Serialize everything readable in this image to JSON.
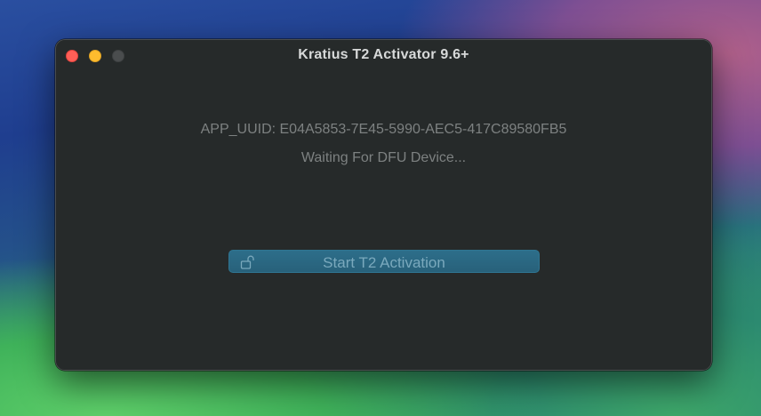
{
  "window": {
    "title": "Kratius T2 Activator 9.6+",
    "traffic_lights": {
      "close": "#fe5f57",
      "minimize": "#febc2e",
      "zoom": "#4a4d4e"
    }
  },
  "main": {
    "uuid_text": "APP_UUID: E04A5853-7E45-5990-AEC5-417C89580FB5",
    "status_text": "Waiting For DFU Device...",
    "start_button": {
      "label": "Start T2 Activation",
      "icon": "unlock-icon",
      "color": "#2d6e8a"
    }
  }
}
